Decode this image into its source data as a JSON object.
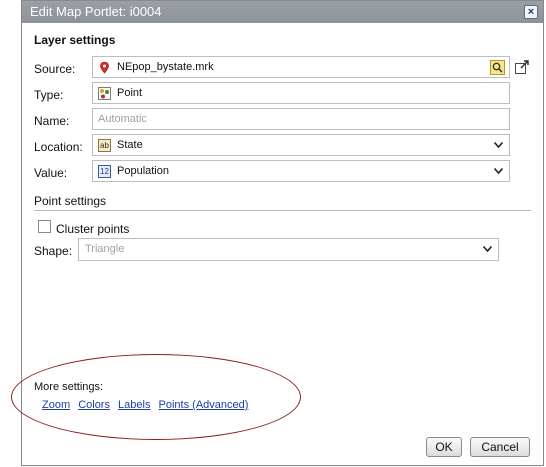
{
  "window": {
    "title": "Edit Map Portlet: i0004",
    "close_glyph": "×"
  },
  "layer_settings": {
    "heading": "Layer settings",
    "source": {
      "label": "Source:",
      "value": "NEpop_bystate.mrk",
      "icon": "map-pin-icon"
    },
    "type": {
      "label": "Type:",
      "value": "Point",
      "icon": "point-layer-icon"
    },
    "name": {
      "label": "Name:",
      "placeholder": "Automatic"
    },
    "location": {
      "label": "Location:",
      "value": "State",
      "icon": "text-field-icon",
      "icon_text": "ab"
    },
    "value": {
      "label": "Value:",
      "value": "Population",
      "icon": "numeric-field-icon",
      "icon_text": "12"
    }
  },
  "point_settings": {
    "heading": "Point settings",
    "cluster_points": {
      "label": "Cluster points",
      "checked": false
    },
    "shape": {
      "label": "Shape:",
      "value": "Triangle"
    }
  },
  "more_settings": {
    "label": "More settings:",
    "links": [
      "Zoom",
      "Colors",
      "Labels",
      "Points (Advanced)"
    ]
  },
  "buttons": {
    "ok": "OK",
    "cancel": "Cancel"
  },
  "colors": {
    "titlebar": "#8c9298",
    "link": "#1b3ea8",
    "annotation_oval": "#8b1a1a"
  }
}
